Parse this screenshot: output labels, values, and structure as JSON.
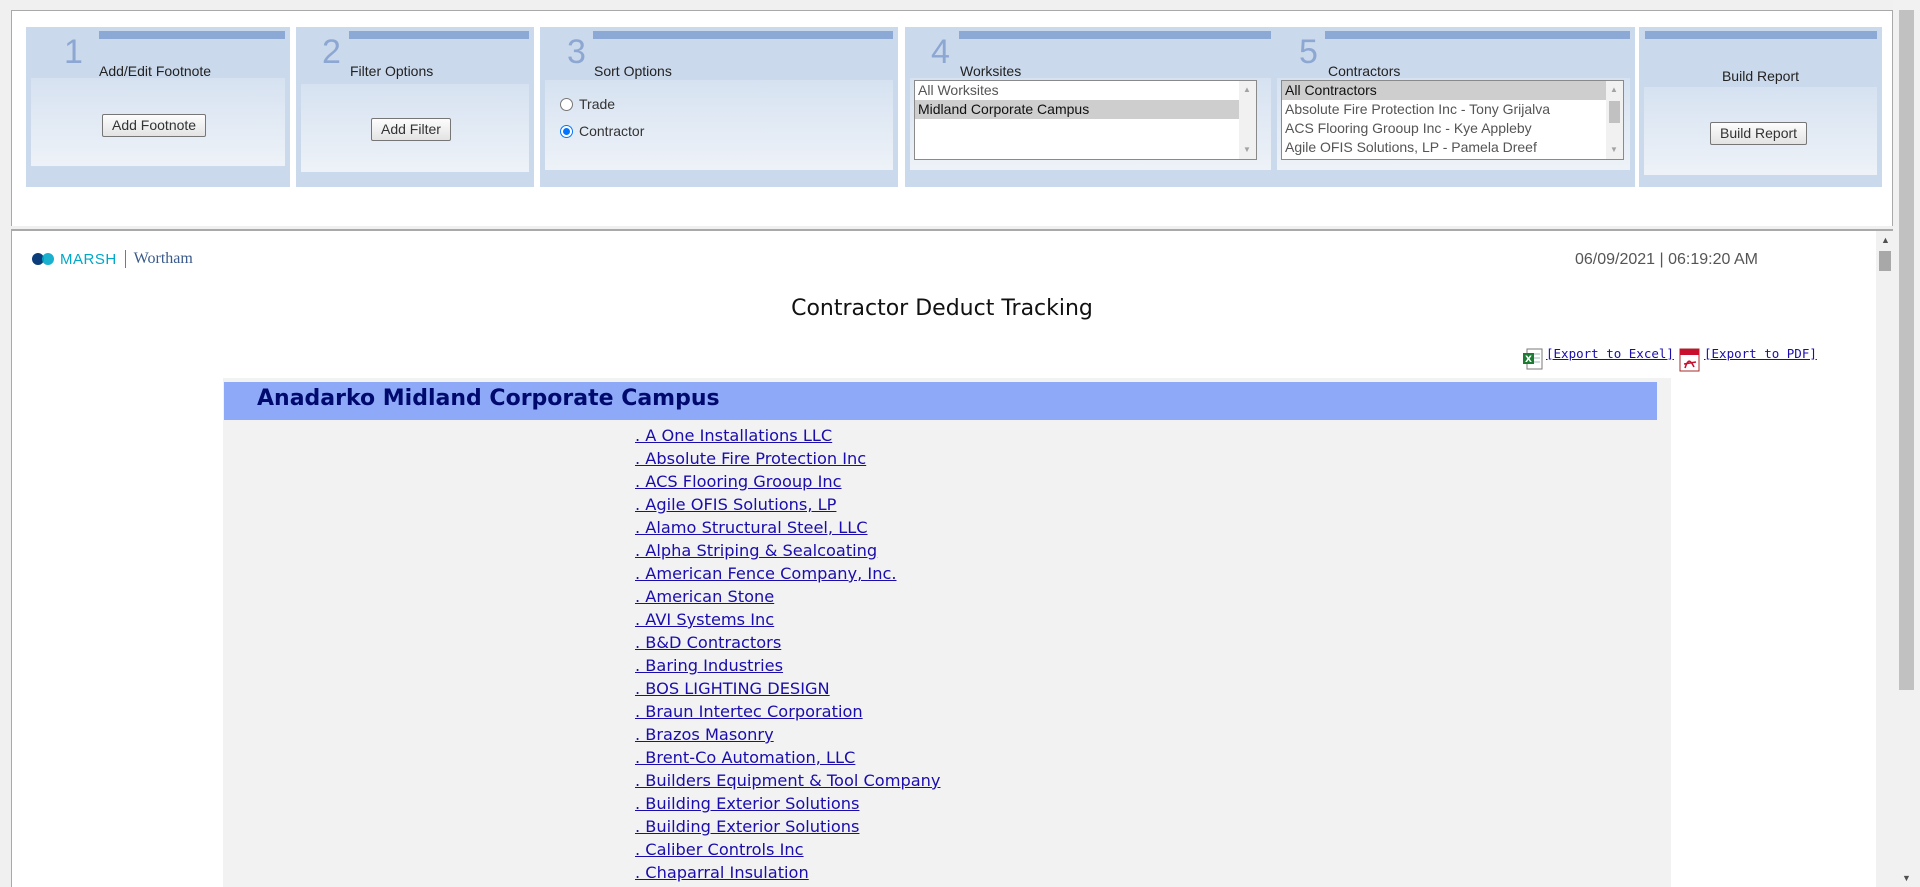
{
  "steps": [
    {
      "number": "1",
      "title": "Add/Edit Footnote",
      "button": "Add Footnote"
    },
    {
      "number": "2",
      "title": "Filter Options",
      "button": "Add Filter"
    },
    {
      "number": "3",
      "title": "Sort Options",
      "radios": [
        {
          "label": "Trade",
          "checked": false
        },
        {
          "label": "Contractor",
          "checked": true
        }
      ]
    },
    {
      "number": "4",
      "title": "Worksites",
      "options": [
        "All Worksites",
        "Midland Corporate Campus"
      ],
      "selected": "Midland Corporate Campus"
    },
    {
      "number": "5",
      "title": "Contractors",
      "options": [
        "All Contractors",
        "Absolute Fire Protection Inc - Tony Grijalva",
        "ACS Flooring Grooup Inc - Kye Appleby",
        "Agile OFIS Solutions, LP - Pamela Dreef"
      ],
      "selected": "All Contractors"
    },
    {
      "title": "Build Report",
      "button": "Build Report"
    }
  ],
  "report": {
    "logo": {
      "brand": "MARSH",
      "partner": "Wortham"
    },
    "datetime": "06/09/2021 | 06:19:20 AM",
    "title": "Contractor Deduct Tracking",
    "export_excel": "[Export to Excel]",
    "export_pdf": "[Export to PDF]",
    "site_header": "Anadarko Midland Corporate Campus",
    "contractors": [
      ". A One Installations LLC",
      ". Absolute Fire Protection Inc",
      ". ACS Flooring Grooup Inc",
      ". Agile OFIS Solutions, LP",
      ". Alamo Structural Steel, LLC",
      ". Alpha Striping & Sealcoating",
      ". American Fence Company, Inc.",
      ". American Stone",
      ". AVI Systems Inc",
      ". B&D Contractors",
      ". Baring Industries",
      ". BOS LIGHTING DESIGN",
      ". Braun Intertec Corporation",
      ". Brazos Masonry",
      ". Brent-Co Automation, LLC",
      ". Builders Equipment & Tool Company",
      ". Building Exterior Solutions",
      ". Building Exterior Solutions",
      ". Caliber Controls Inc",
      ". Chaparral Insulation"
    ]
  },
  "colors": {
    "panel_bg": "#cbd9ec",
    "panel_accent": "#8ba9d4",
    "site_header_bg": "#8ea9f8",
    "link": "#1a0dab"
  }
}
